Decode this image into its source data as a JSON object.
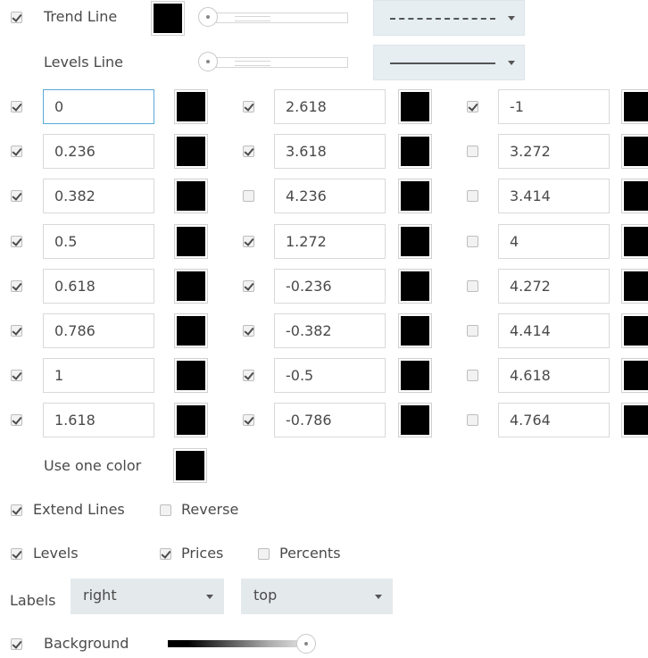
{
  "trend": {
    "label": "Trend Line",
    "checked": true,
    "color": "#000000",
    "style": "dashed"
  },
  "levels_line": {
    "label": "Levels Line",
    "style": "solid"
  },
  "levels": {
    "col1": [
      {
        "value": "0",
        "checked": true
      },
      {
        "value": "0.236",
        "checked": true
      },
      {
        "value": "0.382",
        "checked": true
      },
      {
        "value": "0.5",
        "checked": true
      },
      {
        "value": "0.618",
        "checked": true
      },
      {
        "value": "0.786",
        "checked": true
      },
      {
        "value": "1",
        "checked": true
      },
      {
        "value": "1.618",
        "checked": true
      }
    ],
    "col2": [
      {
        "value": "2.618",
        "checked": true
      },
      {
        "value": "3.618",
        "checked": true
      },
      {
        "value": "4.236",
        "checked": false
      },
      {
        "value": "1.272",
        "checked": true
      },
      {
        "value": "-0.236",
        "checked": true
      },
      {
        "value": "-0.382",
        "checked": true
      },
      {
        "value": "-0.5",
        "checked": true
      },
      {
        "value": "-0.786",
        "checked": true
      }
    ],
    "col3": [
      {
        "value": "-1",
        "checked": true
      },
      {
        "value": "3.272",
        "checked": false
      },
      {
        "value": "3.414",
        "checked": false
      },
      {
        "value": "4",
        "checked": false
      },
      {
        "value": "4.272",
        "checked": false
      },
      {
        "value": "4.414",
        "checked": false
      },
      {
        "value": "4.618",
        "checked": false
      },
      {
        "value": "4.764",
        "checked": false
      }
    ]
  },
  "use_one_color": {
    "label": "Use one color"
  },
  "extend_lines": {
    "label": "Extend Lines",
    "checked": true
  },
  "reverse": {
    "label": "Reverse",
    "checked": false
  },
  "levels_opt": {
    "label": "Levels",
    "checked": true
  },
  "prices_opt": {
    "label": "Prices",
    "checked": true
  },
  "percents_opt": {
    "label": "Percents",
    "checked": false
  },
  "labels": {
    "label": "Labels",
    "horizontal": "right",
    "vertical": "top"
  },
  "background": {
    "label": "Background",
    "checked": true
  }
}
